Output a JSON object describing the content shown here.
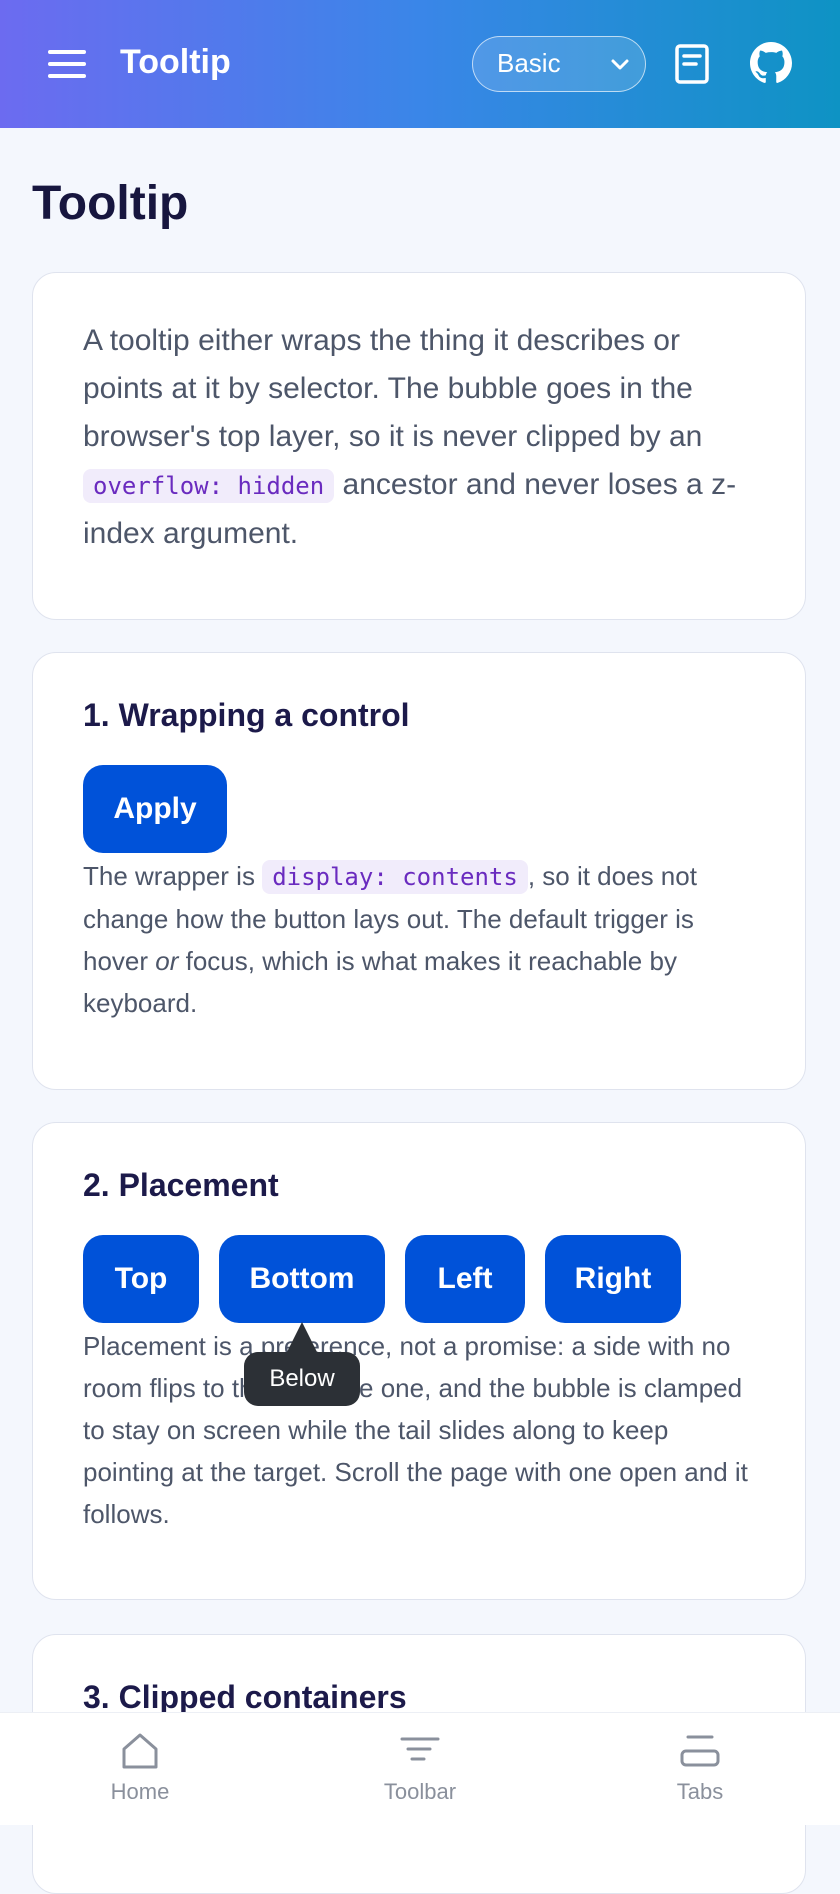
{
  "header": {
    "title": "Tooltip",
    "variant_selected": "Basic"
  },
  "page": {
    "title": "Tooltip"
  },
  "intro": {
    "text_before": "A tooltip either wraps the thing it describes or points at it by selector. The bubble goes in the browser's top layer, so it is never clipped by an ",
    "code": "overflow: hidden",
    "text_after": " ancestor and never loses a z-index argument."
  },
  "section1": {
    "title": "1. Wrapping a control",
    "button_label": "Apply",
    "desc_before": "The wrapper is ",
    "desc_code": "display: contents",
    "desc_middle": ", so it does not change how the button lays out. The default trigger is hover ",
    "desc_em": "or",
    "desc_after": " focus, which is what makes it reachable by keyboard."
  },
  "section2": {
    "title": "2. Placement",
    "buttons": [
      "Top",
      "Bottom",
      "Left",
      "Right"
    ],
    "desc": "Placement is a preference, not a promise: a side with no room flips to the opposite one, and the bubble is clamped to stay on screen while the tail slides along to keep pointing at the target. Scroll the page with one open and it follows.",
    "tooltip": "Below"
  },
  "section3": {
    "title": "3. Clipped containers"
  },
  "nav": {
    "items": [
      {
        "label": "Home",
        "icon": "home-icon"
      },
      {
        "label": "Toolbar",
        "icon": "toolbar-icon"
      },
      {
        "label": "Tabs",
        "icon": "tabs-icon"
      }
    ]
  },
  "colors": {
    "header_gradient_start": "#6c6bf0",
    "header_gradient_end": "#0e93c4",
    "primary_button": "#0052d9",
    "tooltip_bg": "#2c3036"
  }
}
